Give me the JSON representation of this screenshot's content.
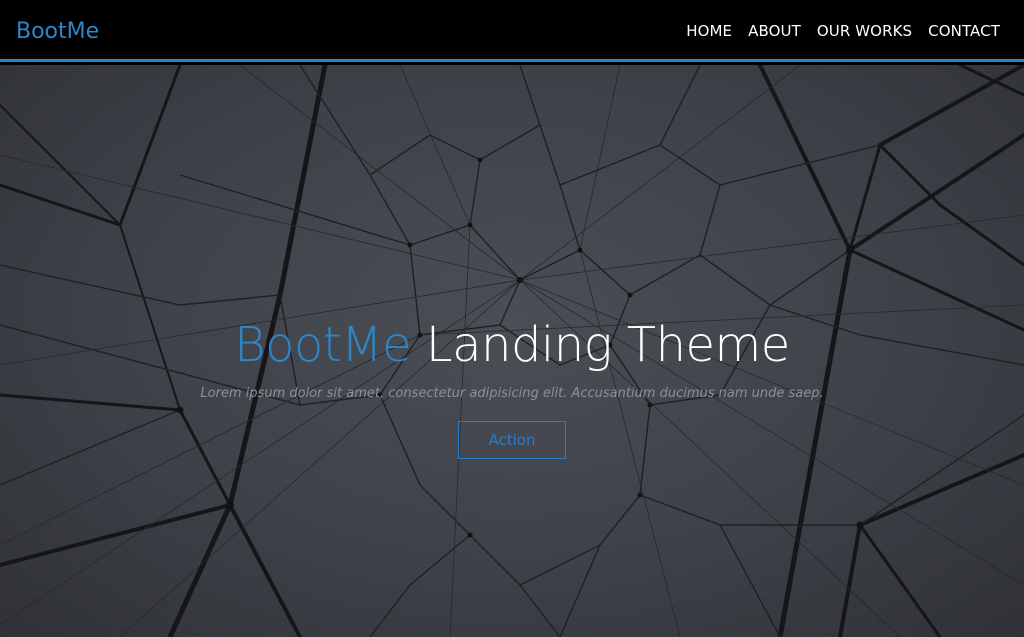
{
  "navbar": {
    "brand": "BootMe",
    "links": [
      "HOME",
      "ABOUT",
      "OUR WORKS",
      "CONTACT"
    ]
  },
  "hero": {
    "title_accent": "BootMe",
    "title_rest": "Landing Theme",
    "subtitle": "Lorem ipsum dolor sit amet, consectetur adipisicing elit. Accusantium ducimus nam unde saep.",
    "action_label": "Action"
  },
  "colors": {
    "accent": "#2e86c9",
    "navbar_background": "#000000",
    "navbar_border": "#2a82c7",
    "hero_background": "#3e4148",
    "button_border": "#2a7bd1"
  }
}
